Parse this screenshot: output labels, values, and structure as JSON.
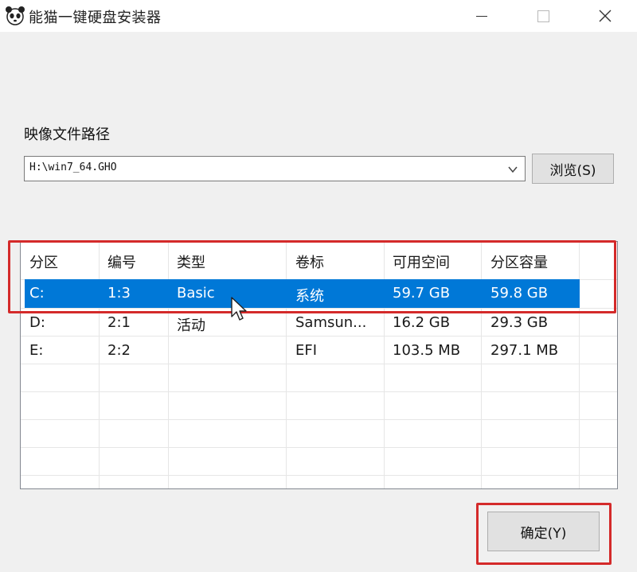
{
  "window": {
    "title": "能猫一键硬盘安装器",
    "app_icon": "panda-icon"
  },
  "image_path": {
    "label": "映像文件路径",
    "value": "H:\\win7_64.GHO",
    "browse_label": "浏览(S)"
  },
  "partitions": {
    "columns": [
      "分区",
      "编号",
      "类型",
      "卷标",
      "可用空间",
      "分区容量"
    ],
    "rows": [
      {
        "partition": "C:",
        "number": "1:3",
        "type": "Basic",
        "label": "系统",
        "free": "59.7 GB",
        "size": "59.8 GB",
        "selected": true
      },
      {
        "partition": "D:",
        "number": "2:1",
        "type": "活动",
        "label": "Samsun...",
        "free": "16.2 GB",
        "size": "29.3 GB",
        "selected": false
      },
      {
        "partition": "E:",
        "number": "2:2",
        "type": "",
        "label": "EFI",
        "free": "103.5 MB",
        "size": "297.1 MB",
        "selected": false
      }
    ]
  },
  "ok_label": "确定(Y)",
  "colors": {
    "selection": "#0078d7",
    "highlight": "#d42a2a"
  }
}
